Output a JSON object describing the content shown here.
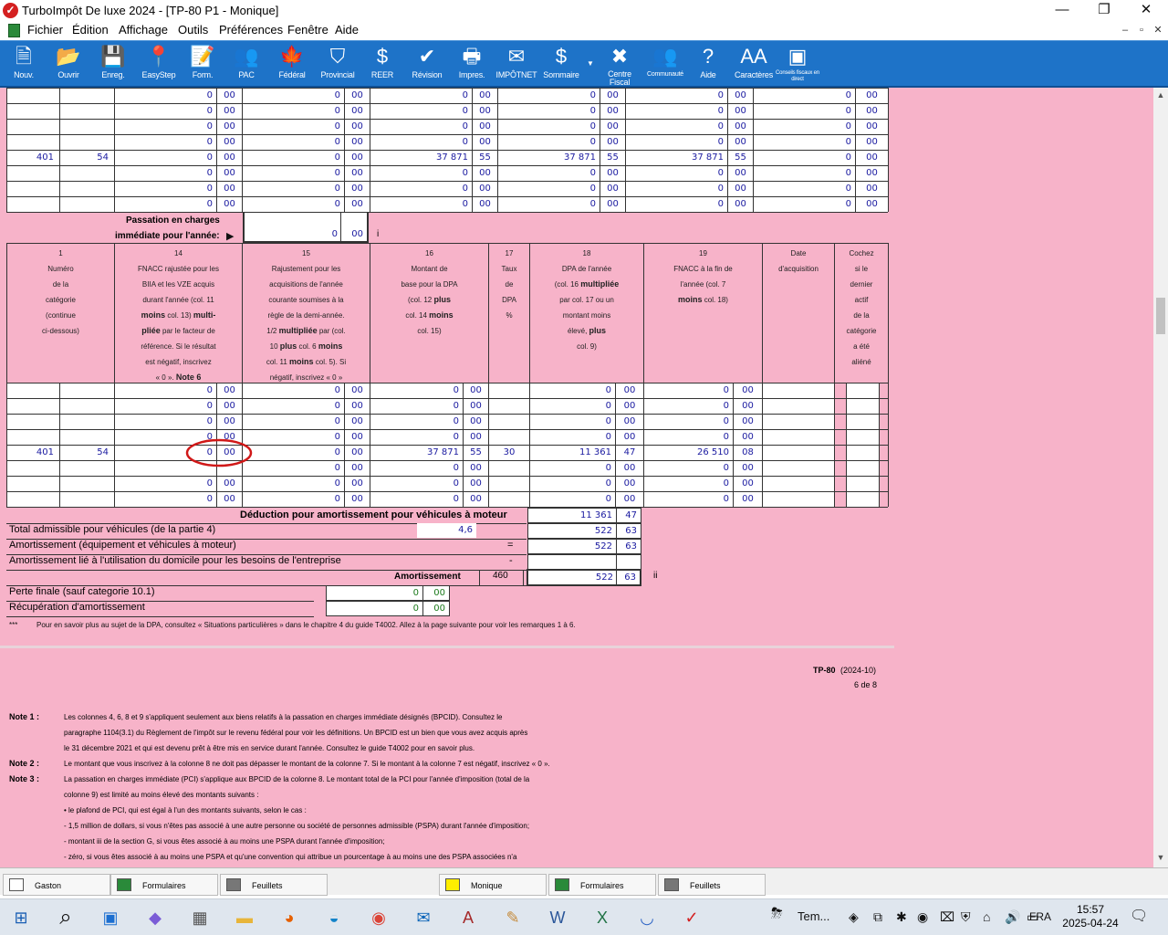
{
  "window": {
    "title": "TurboImpôt De luxe 2024 - [TP-80 P1 - Monique]",
    "minimize": "—",
    "restore": "❐",
    "close": "✕"
  },
  "menu": [
    "Fichier",
    "Édition",
    "Affichage",
    "Outils",
    "Préférences",
    "Fenêtre",
    "Aide"
  ],
  "mdi_buttons": [
    "–",
    "▫",
    "✕"
  ],
  "toolbar": [
    {
      "label": "Nouv.",
      "icon": "new-doc-icon",
      "glyph": "🗎"
    },
    {
      "label": "Ouvrir",
      "icon": "folder-icon",
      "glyph": "📂"
    },
    {
      "label": "Enreg.",
      "icon": "save-icon",
      "glyph": "💾"
    },
    {
      "label": "EasyStep",
      "icon": "location-pin-icon",
      "glyph": "📍"
    },
    {
      "label": "Form.",
      "icon": "form-edit-icon",
      "glyph": "📝"
    },
    {
      "label": "PAC",
      "icon": "people-icon",
      "glyph": "👥"
    },
    {
      "label": "Fédéral",
      "icon": "maple-leaf-icon",
      "glyph": "🍁"
    },
    {
      "label": "Provincial",
      "icon": "shield-icon",
      "glyph": "⛉"
    },
    {
      "label": "REER",
      "icon": "piggy-bank-icon",
      "glyph": "$"
    },
    {
      "label": "Révision",
      "icon": "checkmark-icon",
      "glyph": "✔"
    },
    {
      "label": "Impres.",
      "icon": "printer-icon",
      "glyph": "🖶"
    },
    {
      "label": "IMPÔTNET",
      "icon": "envelope-icon",
      "glyph": "✉"
    },
    {
      "label": "Sommaire",
      "icon": "dollar-icon",
      "glyph": "$"
    },
    {
      "label": "Centre Fiscal",
      "icon": "tools-icon",
      "glyph": "✖"
    },
    {
      "label": "Communauté",
      "icon": "community-icon",
      "glyph": "👥"
    },
    {
      "label": "Aide",
      "icon": "question-icon",
      "glyph": "?"
    },
    {
      "label": "Caractères",
      "icon": "font-size-icon",
      "glyph": "AA"
    },
    {
      "label": "Conseils fiscaux en direct",
      "icon": "live-advice-icon",
      "glyph": "▣"
    }
  ],
  "top_table": {
    "rows": [
      [
        "",
        "",
        "0",
        "00",
        "0",
        "00",
        "0",
        "00",
        "0",
        "00",
        "0",
        "00",
        "0",
        "00"
      ],
      [
        "",
        "",
        "0",
        "00",
        "0",
        "00",
        "0",
        "00",
        "0",
        "00",
        "0",
        "00",
        "0",
        "00"
      ],
      [
        "",
        "",
        "0",
        "00",
        "0",
        "00",
        "0",
        "00",
        "0",
        "00",
        "0",
        "00",
        "0",
        "00"
      ],
      [
        "",
        "",
        "0",
        "00",
        "0",
        "00",
        "0",
        "00",
        "0",
        "00",
        "0",
        "00",
        "0",
        "00"
      ],
      [
        "401",
        "54",
        "0",
        "00",
        "0",
        "00",
        "37 871",
        "55",
        "37 871",
        "55",
        "37 871",
        "55",
        "0",
        "00"
      ],
      [
        "",
        "",
        "0",
        "00",
        "0",
        "00",
        "0",
        "00",
        "0",
        "00",
        "0",
        "00",
        "0",
        "00"
      ],
      [
        "",
        "",
        "0",
        "00",
        "0",
        "00",
        "0",
        "00",
        "0",
        "00",
        "0",
        "00",
        "0",
        "00"
      ],
      [
        "",
        "",
        "0",
        "00",
        "0",
        "00",
        "0",
        "00",
        "0",
        "00",
        "0",
        "00",
        "0",
        "00"
      ]
    ]
  },
  "passation": {
    "line1": "Passation en charges",
    "line2": "immédiate pour l'année:",
    "value": "0",
    "cents": "00",
    "marker": "i"
  },
  "headers": [
    {
      "num": "1",
      "lines": [
        "Numéro",
        "de la",
        "catégorie",
        "(continue",
        "ci-dessous)"
      ]
    },
    {
      "num": "14",
      "lines": [
        "FNACC rajustée pour les",
        "BIIA et les VZE acquis",
        "durant l'année (col. 11",
        "<b>moins</b> col. 13) <b>multi-</b>",
        "<b>pliée</b> par le facteur de",
        "référence. Si le résultat",
        "est négatif, inscrivez",
        "« 0 ». <b>Note 6</b>"
      ]
    },
    {
      "num": "15",
      "lines": [
        "Rajustement pour les",
        "acquisitions de l'année",
        "courante soumises à la",
        "règle de la demi-année.",
        "1/2 <b>multipliée</b> par (col.",
        "10 <b>plus</b> col. 6 <b>moins</b>",
        "col. 11 <b>moins</b> col. 5). Si",
        "négatif, inscrivez « 0 »"
      ]
    },
    {
      "num": "16",
      "lines": [
        "Montant de",
        "base pour la DPA",
        "(col. 12 <b>plus</b>",
        "col. 14 <b>moins</b>",
        "col. 15)"
      ]
    },
    {
      "num": "17",
      "lines": [
        "Taux",
        "de",
        "DPA",
        "%"
      ]
    },
    {
      "num": "18",
      "lines": [
        "DPA de l'année",
        "(col. 16 <b>multipliée</b>",
        "par col. 17 ou un",
        "montant moins",
        "élevé, <b>plus</b>",
        "col. 9)"
      ]
    },
    {
      "num": "19",
      "lines": [
        "FNACC à la fin de",
        "l'année (col. 7",
        "<b>moins</b> col. 18)"
      ]
    },
    {
      "num": "",
      "lines": [
        "Date",
        "d'acquisition"
      ]
    },
    {
      "num": "",
      "lines": [
        "Cochez",
        "si le",
        "dernier",
        "actif",
        "de la",
        "catégorie",
        "a été",
        "aliéné"
      ]
    }
  ],
  "bottom_table": {
    "rows": [
      [
        "",
        "",
        "0",
        "00",
        "0",
        "00",
        "0",
        "00",
        "",
        "0",
        "00",
        "0",
        "00"
      ],
      [
        "",
        "",
        "0",
        "00",
        "0",
        "00",
        "0",
        "00",
        "",
        "0",
        "00",
        "0",
        "00"
      ],
      [
        "",
        "",
        "0",
        "00",
        "0",
        "00",
        "0",
        "00",
        "",
        "0",
        "00",
        "0",
        "00"
      ],
      [
        "",
        "",
        "0",
        "00",
        "0",
        "00",
        "0",
        "00",
        "",
        "0",
        "00",
        "0",
        "00"
      ],
      [
        "401",
        "54",
        "0",
        "00",
        "0",
        "00",
        "37 871",
        "55",
        "30",
        "11 361",
        "47",
        "26 510",
        "08"
      ],
      [
        "",
        "",
        "",
        "",
        "0",
        "00",
        "0",
        "00",
        "",
        "0",
        "00",
        "0",
        "00"
      ],
      [
        "",
        "",
        "0",
        "00",
        "0",
        "00",
        "0",
        "00",
        "",
        "0",
        "00",
        "0",
        "00"
      ],
      [
        "",
        "",
        "0",
        "00",
        "0",
        "00",
        "0",
        "00",
        "",
        "0",
        "00",
        "0",
        "00"
      ]
    ]
  },
  "summary": {
    "deduction_label": "Déduction pour amortissement pour véhicules à moteur",
    "deduction_value": "11 361",
    "deduction_cents": "47",
    "total_label": "Total admissible pour véhicules (de la partie 4)",
    "total_ratio": "4,6",
    "total_value": "522",
    "total_cents": "63",
    "amort_equip_label": "Amortissement (équipement et véhicules à moteur)",
    "equals": "=",
    "amort_equip_value": "522",
    "amort_equip_cents": "63",
    "domicile_label": "Amortissement lié à l'utilisation du domicile pour les besoins de l'entreprise",
    "minus": "-",
    "amort_label": "Amortissement",
    "amort_line": "460",
    "amort_value": "522",
    "amort_cents": "63",
    "amort_marker": "ii",
    "perte_label": "Perte finale (sauf categorie 10.1)",
    "perte_value": "0",
    "perte_cents": "00",
    "recup_label": "Récupération d'amortissement",
    "recup_value": "0",
    "recup_cents": "00",
    "footnote_mark": "***",
    "footnote": "Pour en savoir plus au sujet de la DPA, consultez « Situations particulières » dans le chapitre 4 du guide T4002. Allez à la page suivante pour voir les remarques 1 à 6."
  },
  "page_footer": {
    "form_id": "TP-80",
    "form_date": "(2024-10)",
    "page": "6 de 8"
  },
  "notes": [
    {
      "label": "Note 1 :",
      "lines": [
        "Les colonnes 4, 6, 8 et 9 s'appliquent seulement aux biens relatifs à la passation en charges immédiate désignés (BPCID). Consultez le",
        "paragraphe 1104(3.1) du Règlement de l'impôt sur le revenu fédéral pour voir les définitions. Un BPCID est un bien que vous avez acquis après",
        "le 31 décembre 2021 et qui est devenu prêt à être mis en service durant l'année. Consultez le guide T4002 pour en savoir plus."
      ]
    },
    {
      "label": "Note 2 :",
      "lines": [
        "Le montant que vous inscrivez à la colonne 8 ne doit pas dépasser le montant de la colonne 7. Si le montant à la colonne 7 est négatif, inscrivez « 0 »."
      ]
    },
    {
      "label": "Note 3 :",
      "lines": [
        "La passation en charges immédiate (PCI) s'applique aux BPCID de la colonne 8. Le montant total de la PCI pour l'année d'imposition (total de la",
        "colonne 9) est limité au moins élevé des montants suivants :",
        "• le plafond de PCI, qui est égal à l'un des montants suivants, selon le cas :",
        "   - 1,5 million de dollars, si vous n'êtes pas associé à une autre personne ou société de personnes admissible (PSPA) durant l'année d'imposition;",
        "   - montant iii de la section G, si vous êtes associé à au moins une PSPA durant l'année d'imposition;",
        "   - zéro, si vous êtes associé à au moins une PSPA et qu'une convention qui attribue un pourcentage à au moins une des PSPA associées n'a"
      ]
    }
  ],
  "window_tabs": [
    {
      "label": "Gaston",
      "icon": "blank-doc-icon"
    },
    {
      "label": "Formulaires",
      "icon": "forms-icon"
    },
    {
      "label": "Feuillets",
      "icon": "slips-icon"
    },
    {
      "label": "Monique",
      "icon": "yellow-doc-icon"
    },
    {
      "label": "Formulaires",
      "icon": "forms-icon"
    },
    {
      "label": "Feuillets",
      "icon": "slips-icon"
    }
  ],
  "taskbar": {
    "apps": [
      "windows-start-icon",
      "search-icon",
      "store-icon",
      "copilot-icon",
      "calculator-icon",
      "file-explorer-icon",
      "firefox-icon",
      "edge-icon",
      "chrome-icon",
      "outlook-icon",
      "access-icon",
      "paint-icon",
      "word-icon",
      "excel-icon",
      "tray-app-icon",
      "turboimpot-icon"
    ],
    "weather": "Tem...",
    "lang": "FRA",
    "time": "15:57",
    "date": "2025-04-24"
  }
}
